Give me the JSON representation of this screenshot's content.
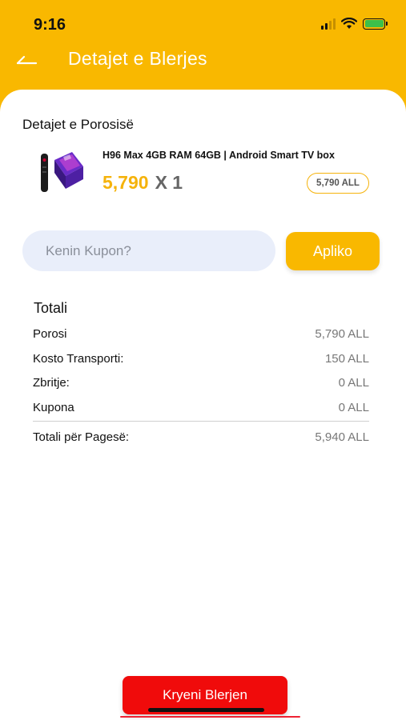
{
  "status_bar": {
    "time": "9:16"
  },
  "header": {
    "title": "Detajet e Blerjes",
    "back_icon": "back-arrow-icon"
  },
  "order": {
    "section_title": "Detajet e Porosisë",
    "product_name": "H96 Max 4GB RAM 64GB | Android Smart TV box",
    "price": "5,790",
    "quantity": "X 1",
    "line_total": "5,790 ALL"
  },
  "coupon": {
    "placeholder": "Kenin Kupon?",
    "value": "",
    "apply_label": "Apliko"
  },
  "totals": {
    "title": "Totali",
    "rows": [
      {
        "label": "Porosi",
        "value": "5,790 ALL"
      },
      {
        "label": "Kosto Transporti:",
        "value": "150 ALL"
      },
      {
        "label": "Zbritje:",
        "value": "0 ALL"
      },
      {
        "label": "Kupona",
        "value": "0 ALL"
      }
    ],
    "grand_total": {
      "label": "Totali për Pagesë:",
      "value": "5,940 ALL"
    }
  },
  "footer": {
    "pay_label": "Kryeni Blerjen"
  },
  "colors": {
    "accent": "#f9b800",
    "price": "#f5b30c",
    "danger": "#f00b0b",
    "input_bg": "#e9eefa"
  }
}
